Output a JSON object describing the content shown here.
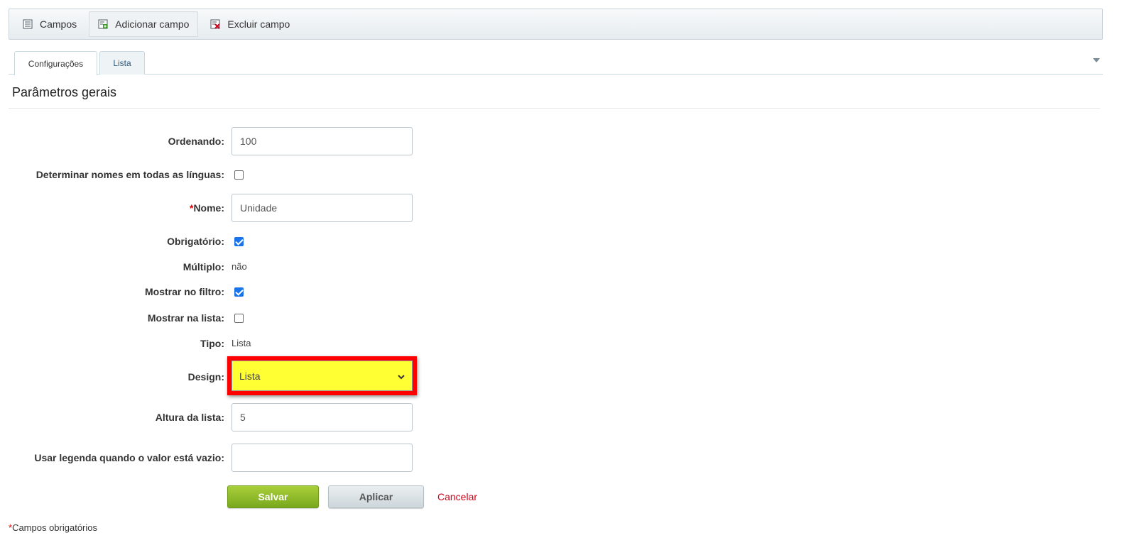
{
  "toolbar": {
    "items": [
      {
        "label": "Campos",
        "icon": "list-icon"
      },
      {
        "label": "Adicionar campo",
        "icon": "add-field-icon"
      },
      {
        "label": "Excluir campo",
        "icon": "delete-field-icon"
      }
    ]
  },
  "tabs": [
    {
      "label": "Configurações",
      "selected": true
    },
    {
      "label": "Lista",
      "selected": false
    }
  ],
  "section": {
    "title": "Parâmetros gerais"
  },
  "form": {
    "ordenando": {
      "label": "Ordenando:",
      "value": "100"
    },
    "determinar": {
      "label": "Determinar nomes em todas as línguas:",
      "checked": false
    },
    "nome": {
      "required_mark": "*",
      "label": "Nome:",
      "value": "Unidade"
    },
    "obrigatorio": {
      "label": "Obrigatório:",
      "checked": true
    },
    "multiplo": {
      "label": "Múltiplo:",
      "value": "não"
    },
    "mostrar_filtro": {
      "label": "Mostrar no filtro:",
      "checked": true
    },
    "mostrar_lista": {
      "label": "Mostrar na lista:",
      "checked": false
    },
    "tipo": {
      "label": "Tipo:",
      "value": "Lista"
    },
    "design": {
      "label": "Design:",
      "value": "Lista",
      "highlight_color": "#ffff33",
      "border_color": "#ff0000"
    },
    "altura": {
      "label": "Altura da lista:",
      "value": "5"
    },
    "legenda": {
      "label": "Usar legenda quando o valor está vazio:",
      "value": ""
    }
  },
  "buttons": {
    "save": "Salvar",
    "apply": "Aplicar",
    "cancel": "Cancelar"
  },
  "footer": {
    "required_mark": "*",
    "note": "Campos obrigatórios"
  },
  "colors": {
    "accent_green": "#8ab82c",
    "cancel_red": "#d0021b",
    "check_blue": "#1a73e8"
  }
}
